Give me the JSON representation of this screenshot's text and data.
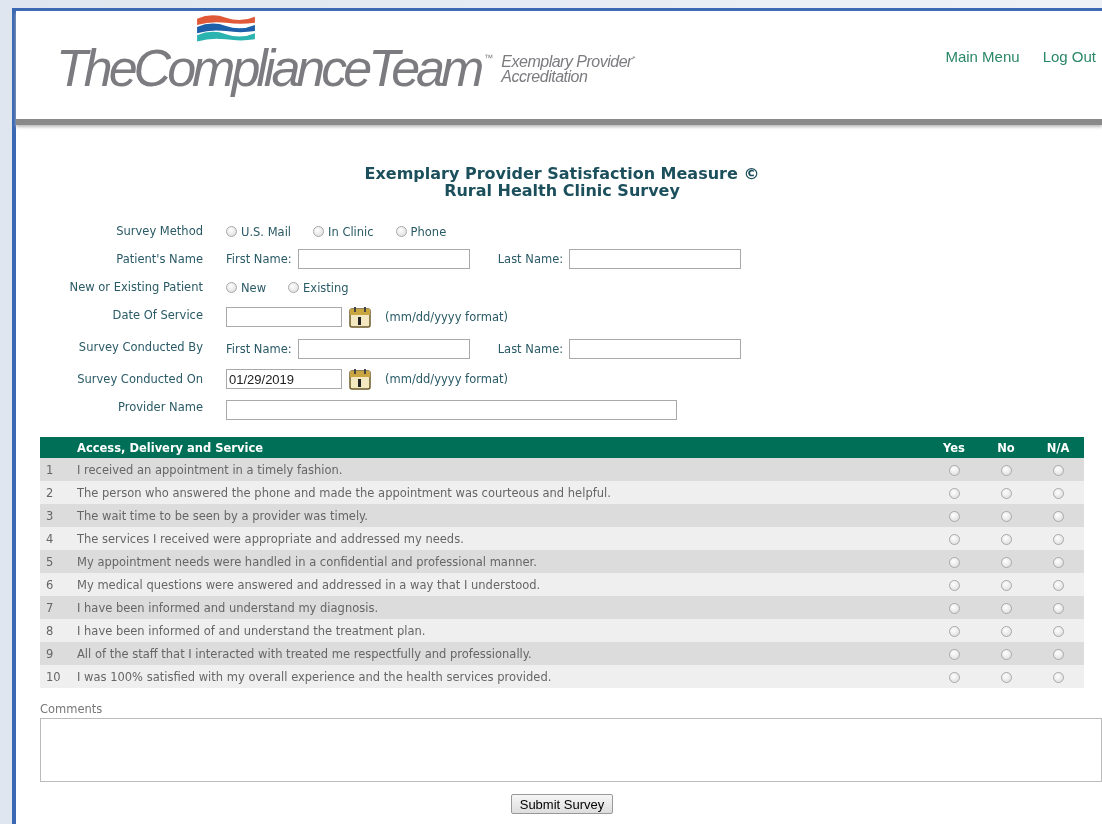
{
  "header": {
    "logo": {
      "name": "TheComplianceTeam",
      "tm": "™",
      "tagline_1": "Exemplary Provider",
      "tagline_mark": "*",
      "tagline_2": "Accreditation"
    },
    "nav": [
      {
        "label": "Main Menu"
      },
      {
        "label": "Log Out"
      }
    ]
  },
  "title": [
    "Exemplary Provider Satisfaction Measure ©",
    "Rural Health Clinic Survey"
  ],
  "form": [
    {
      "kind": "radio",
      "label": "Survey Method",
      "options": [
        {
          "label": "U.S. Mail",
          "selected": false
        },
        {
          "label": "In Clinic",
          "selected": false
        },
        {
          "label": "Phone",
          "selected": false
        }
      ]
    },
    {
      "kind": "name",
      "label": "Patient's Name",
      "first_label": "First Name:",
      "last_label": "Last Name:"
    },
    {
      "kind": "radio",
      "label": "New or Existing Patient",
      "options": [
        {
          "label": "New",
          "selected": false
        },
        {
          "label": "Existing",
          "selected": false
        }
      ]
    },
    {
      "kind": "date",
      "label": "Date Of Service",
      "hint": "(mm/dd/yyyy format)"
    },
    {
      "kind": "name",
      "label": "Survey Conducted By",
      "first_label": "First Name:",
      "last_label": "Last Name:"
    },
    {
      "kind": "date",
      "label": "Survey Conducted On",
      "value": "01/29/2019",
      "hint": "(mm/dd/yyyy format)"
    },
    {
      "kind": "text",
      "label": "Provider Name"
    }
  ],
  "table": {
    "columns": [
      "Access, Delivery and Service",
      "Yes",
      "No",
      "N/A"
    ],
    "rows": [
      {
        "number": "1",
        "text": "I received an appointment in a timely fashion.",
        "answers": [
          {
            "selected": false
          },
          {
            "selected": false
          },
          {
            "selected": false
          }
        ]
      },
      {
        "number": "2",
        "text": "The person who answered the phone and made the appointment was courteous and helpful.",
        "answers": [
          {
            "selected": false
          },
          {
            "selected": false
          },
          {
            "selected": false
          }
        ]
      },
      {
        "number": "3",
        "text": "The wait time to be seen by a provider was timely.",
        "answers": [
          {
            "selected": false
          },
          {
            "selected": false
          },
          {
            "selected": false
          }
        ]
      },
      {
        "number": "4",
        "text": "The services I received were appropriate and addressed my needs.",
        "answers": [
          {
            "selected": false
          },
          {
            "selected": false
          },
          {
            "selected": false
          }
        ]
      },
      {
        "number": "5",
        "text": "My appointment needs were handled in a confidential and professional manner.",
        "answers": [
          {
            "selected": false
          },
          {
            "selected": false
          },
          {
            "selected": false
          }
        ]
      },
      {
        "number": "6",
        "text": "My medical questions were answered and addressed in a way that I understood.",
        "answers": [
          {
            "selected": false
          },
          {
            "selected": false
          },
          {
            "selected": false
          }
        ]
      },
      {
        "number": "7",
        "text": "I have been informed and understand my diagnosis.",
        "answers": [
          {
            "selected": false
          },
          {
            "selected": false
          },
          {
            "selected": false
          }
        ]
      },
      {
        "number": "8",
        "text": "I have been informed of and understand the treatment plan.",
        "answers": [
          {
            "selected": false
          },
          {
            "selected": false
          },
          {
            "selected": false
          }
        ]
      },
      {
        "number": "9",
        "text": "All of the staff that I interacted with treated me respectfully and professionally.",
        "answers": [
          {
            "selected": false
          },
          {
            "selected": false
          },
          {
            "selected": false
          }
        ]
      },
      {
        "number": "10",
        "text": "I was 100% satisfied with my overall experience and the health services provided.",
        "answers": [
          {
            "selected": false
          },
          {
            "selected": false
          },
          {
            "selected": false
          }
        ]
      }
    ]
  },
  "comments": {
    "label": "Comments"
  },
  "submit": {
    "label": "Submit Survey"
  }
}
